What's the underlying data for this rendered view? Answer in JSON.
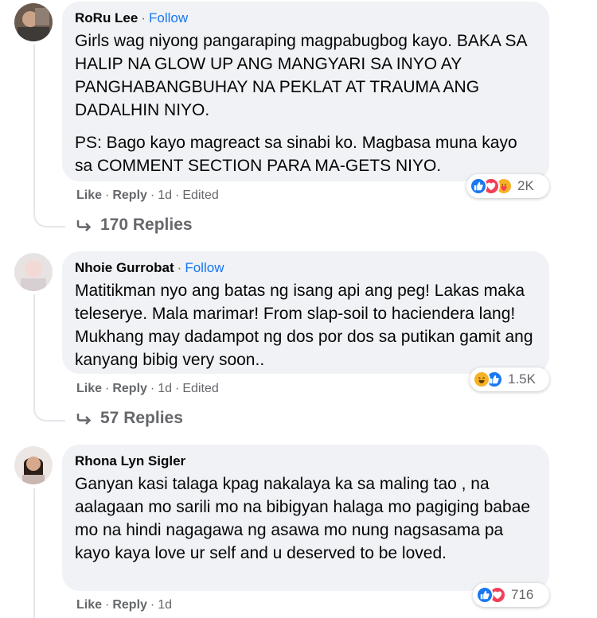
{
  "comments": [
    {
      "author": "RoRu Lee",
      "follow": "Follow",
      "paragraphs": [
        "Girls wag niyong pangaraping magpabugbog kayo. BAKA SA HALIP NA GLOW UP ANG MANGYARI SA INYO AY PANGHABANGBUHAY NA PEKLAT AT TRAUMA ANG DADALHIN NIYO.",
        "PS: Bago kayo magreact sa sinabi ko. Magbasa muna kayo sa COMMENT SECTION PARA MA-GETS NIYO."
      ],
      "like": "Like",
      "reply": "Reply",
      "time": "1d",
      "edited": "Edited",
      "reaction_icons": [
        "like-icon",
        "love-icon",
        "care-icon"
      ],
      "reaction_count": "2K",
      "replies": "170 Replies"
    },
    {
      "author": "Nhoie Gurrobat",
      "follow": "Follow",
      "paragraphs": [
        "Matitikman nyo ang batas ng isang api ang peg! Lakas maka teleserye. Mala marimar! From slap-soil to haciendera lang! Mukhang may dadampot ng dos por dos sa putikan gamit ang kanyang bibig very soon.."
      ],
      "like": "Like",
      "reply": "Reply",
      "time": "1d",
      "edited": "Edited",
      "reaction_icons": [
        "haha-icon",
        "like-icon"
      ],
      "reaction_count": "1.5K",
      "replies": "57 Replies"
    },
    {
      "author": "Rhona Lyn Sigler",
      "paragraphs": [
        "Ganyan kasi talaga kpag nakalaya ka sa maling tao , na aalagaan mo sarili mo na bibigyan halaga mo pagiging babae mo na hindi nagagawa ng asawa mo nung nagsasama pa kayo kaya love ur self and u deserved to be loved."
      ],
      "like": "Like",
      "reply": "Reply",
      "time": "1d",
      "reaction_icons": [
        "like-icon",
        "love-icon"
      ],
      "reaction_count": "716"
    }
  ],
  "colors": {
    "link_blue": "#1877f2",
    "bubble_bg": "#f0f2f5",
    "muted_text": "#65676b",
    "like_blue": "#1877f2",
    "love_red": "#f33e58",
    "haha_yellow": "#f7b125"
  }
}
